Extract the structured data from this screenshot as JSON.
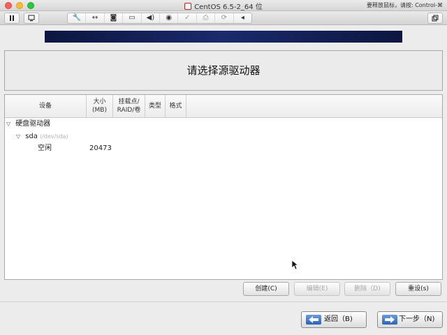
{
  "window": {
    "title": "CentOS 6.5-2_64 位",
    "release_hint": "要释放鼠标，请按: Control-⌘"
  },
  "toolbar": {
    "pause_icon": "pause-icon",
    "screen_icon": "screen-icon",
    "icons": [
      "wrench-icon",
      "arrows-icon",
      "disk-icon",
      "hdd-icon",
      "speaker-icon",
      "camera-icon",
      "usb-icon",
      "printer-icon",
      "share-icon",
      "collapse-icon"
    ],
    "fullscreen_icon": "fullscreen-icon"
  },
  "installer": {
    "page_title": "请选择源驱动器",
    "columns": {
      "device": "设备",
      "size_line1": "大小",
      "size_line2": "(MB)",
      "mount_line1": "挂载点/",
      "mount_line2": "RAID/卷",
      "type": "类型",
      "format": "格式"
    },
    "tree": {
      "group_label": "硬盘驱动器",
      "disk_name": "sda",
      "disk_path": "(/dev/sda)",
      "free_label": "空闲",
      "free_size": "20473"
    },
    "buttons": {
      "create": "创建(C)",
      "edit": "编辑(E)",
      "delete": "删除（D)",
      "reset": "重设(s)",
      "back": "返回（B)",
      "next": "下一步（N)"
    }
  }
}
